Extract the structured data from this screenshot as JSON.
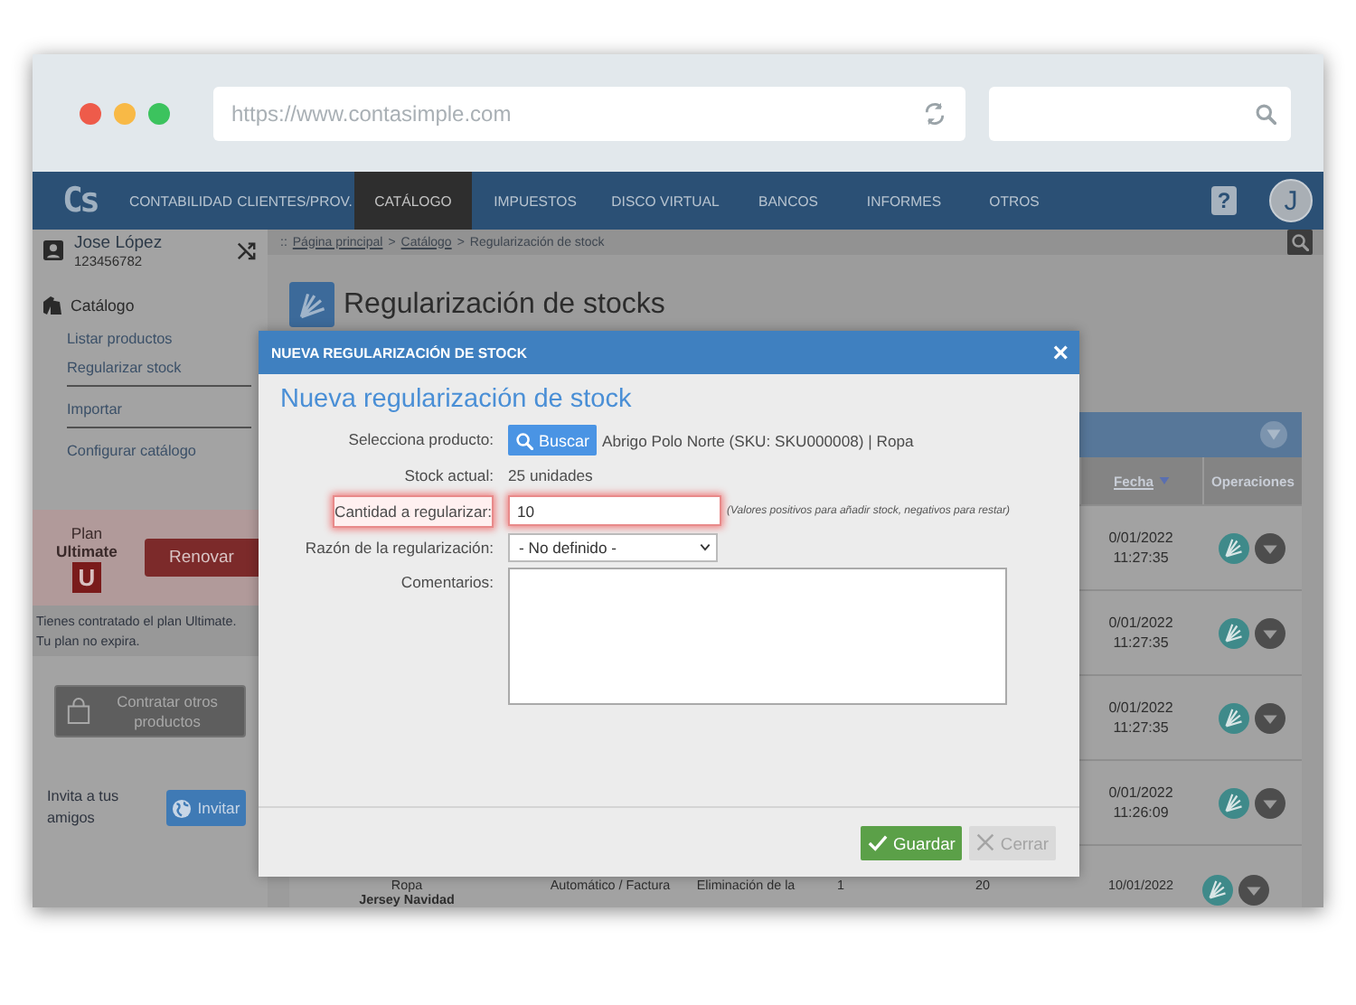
{
  "browser": {
    "url": "https://www.contasimple.com"
  },
  "nav": {
    "logo": "Cs",
    "items": [
      {
        "label": "CONTABILIDAD",
        "selected": false
      },
      {
        "label": "CLIENTES/PROV.",
        "selected": false
      },
      {
        "label": "CATÁLOGO",
        "selected": true
      },
      {
        "label": "IMPUESTOS",
        "selected": false
      },
      {
        "label": "DISCO VIRTUAL",
        "selected": false
      },
      {
        "label": "BANCOS",
        "selected": false
      },
      {
        "label": "INFORMES",
        "selected": false
      },
      {
        "label": "OTROS",
        "selected": false
      }
    ],
    "help": "?",
    "avatar": "J"
  },
  "user": {
    "name": "Jose López",
    "id": "123456782"
  },
  "sidebar": {
    "section": "Catálogo",
    "items": [
      {
        "label": "Listar productos"
      },
      {
        "label": "Regularizar stock"
      },
      {
        "label": "Importar"
      },
      {
        "label": "Configurar catálogo"
      }
    ]
  },
  "plan": {
    "title": "Plan",
    "name": "Ultimate",
    "badge": "U",
    "renew": "Renovar",
    "notes": [
      "Tienes contratado el plan Ultimate.",
      "Tu plan no expira."
    ]
  },
  "contract_button": "Contratar otros productos",
  "invite": {
    "text": "Invita a tus amigos",
    "button": "Invitar"
  },
  "breadcrumb": {
    "prefix": "::",
    "separator": ">",
    "items": [
      "Página principal",
      "Catálogo",
      "Regularización de stock"
    ]
  },
  "page_title": "Regularización de stocks",
  "table": {
    "columns": [
      {
        "label": "Fecha",
        "sortable": true
      },
      {
        "label": "Operaciones",
        "sortable": false
      }
    ],
    "rows": [
      {
        "date": "0/01/2022",
        "time": "11:27:35"
      },
      {
        "date": "0/01/2022",
        "time": "11:27:35"
      },
      {
        "date": "0/01/2022",
        "time": "11:27:35"
      },
      {
        "date": "0/01/2022",
        "time": "11:26:09"
      }
    ],
    "last_row": {
      "category": "Ropa",
      "product": "Jersey Navidad",
      "origin": "Automático / Factura",
      "reason": "Eliminación de la",
      "column_4": "1",
      "column_5": "20",
      "date": "10/01/2022"
    }
  },
  "modal": {
    "header": "NUEVA REGULARIZACIÓN DE STOCK",
    "close": "×",
    "title": "Nueva regularización de stock",
    "fields": [
      {
        "kind": "product",
        "label": "Selecciona producto:",
        "button": "Buscar",
        "value": "Abrigo Polo Norte (SKU: SKU000008) | Ropa"
      },
      {
        "kind": "text",
        "label": "Stock actual:",
        "value": "25 unidades"
      },
      {
        "kind": "input",
        "label": "Cantidad a regularizar:",
        "value": "10",
        "hint": "(Valores positivos para añadir stock, negativos para restar)",
        "highlighted": true
      },
      {
        "kind": "select",
        "label": "Razón de la regularización:",
        "value": "- No definido -"
      },
      {
        "kind": "textarea",
        "label": "Comentarios:"
      }
    ],
    "buttons": [
      {
        "label": "Guardar",
        "kind": "primary",
        "disabled": false
      },
      {
        "label": "Cerrar",
        "kind": "secondary",
        "disabled": true
      }
    ]
  }
}
